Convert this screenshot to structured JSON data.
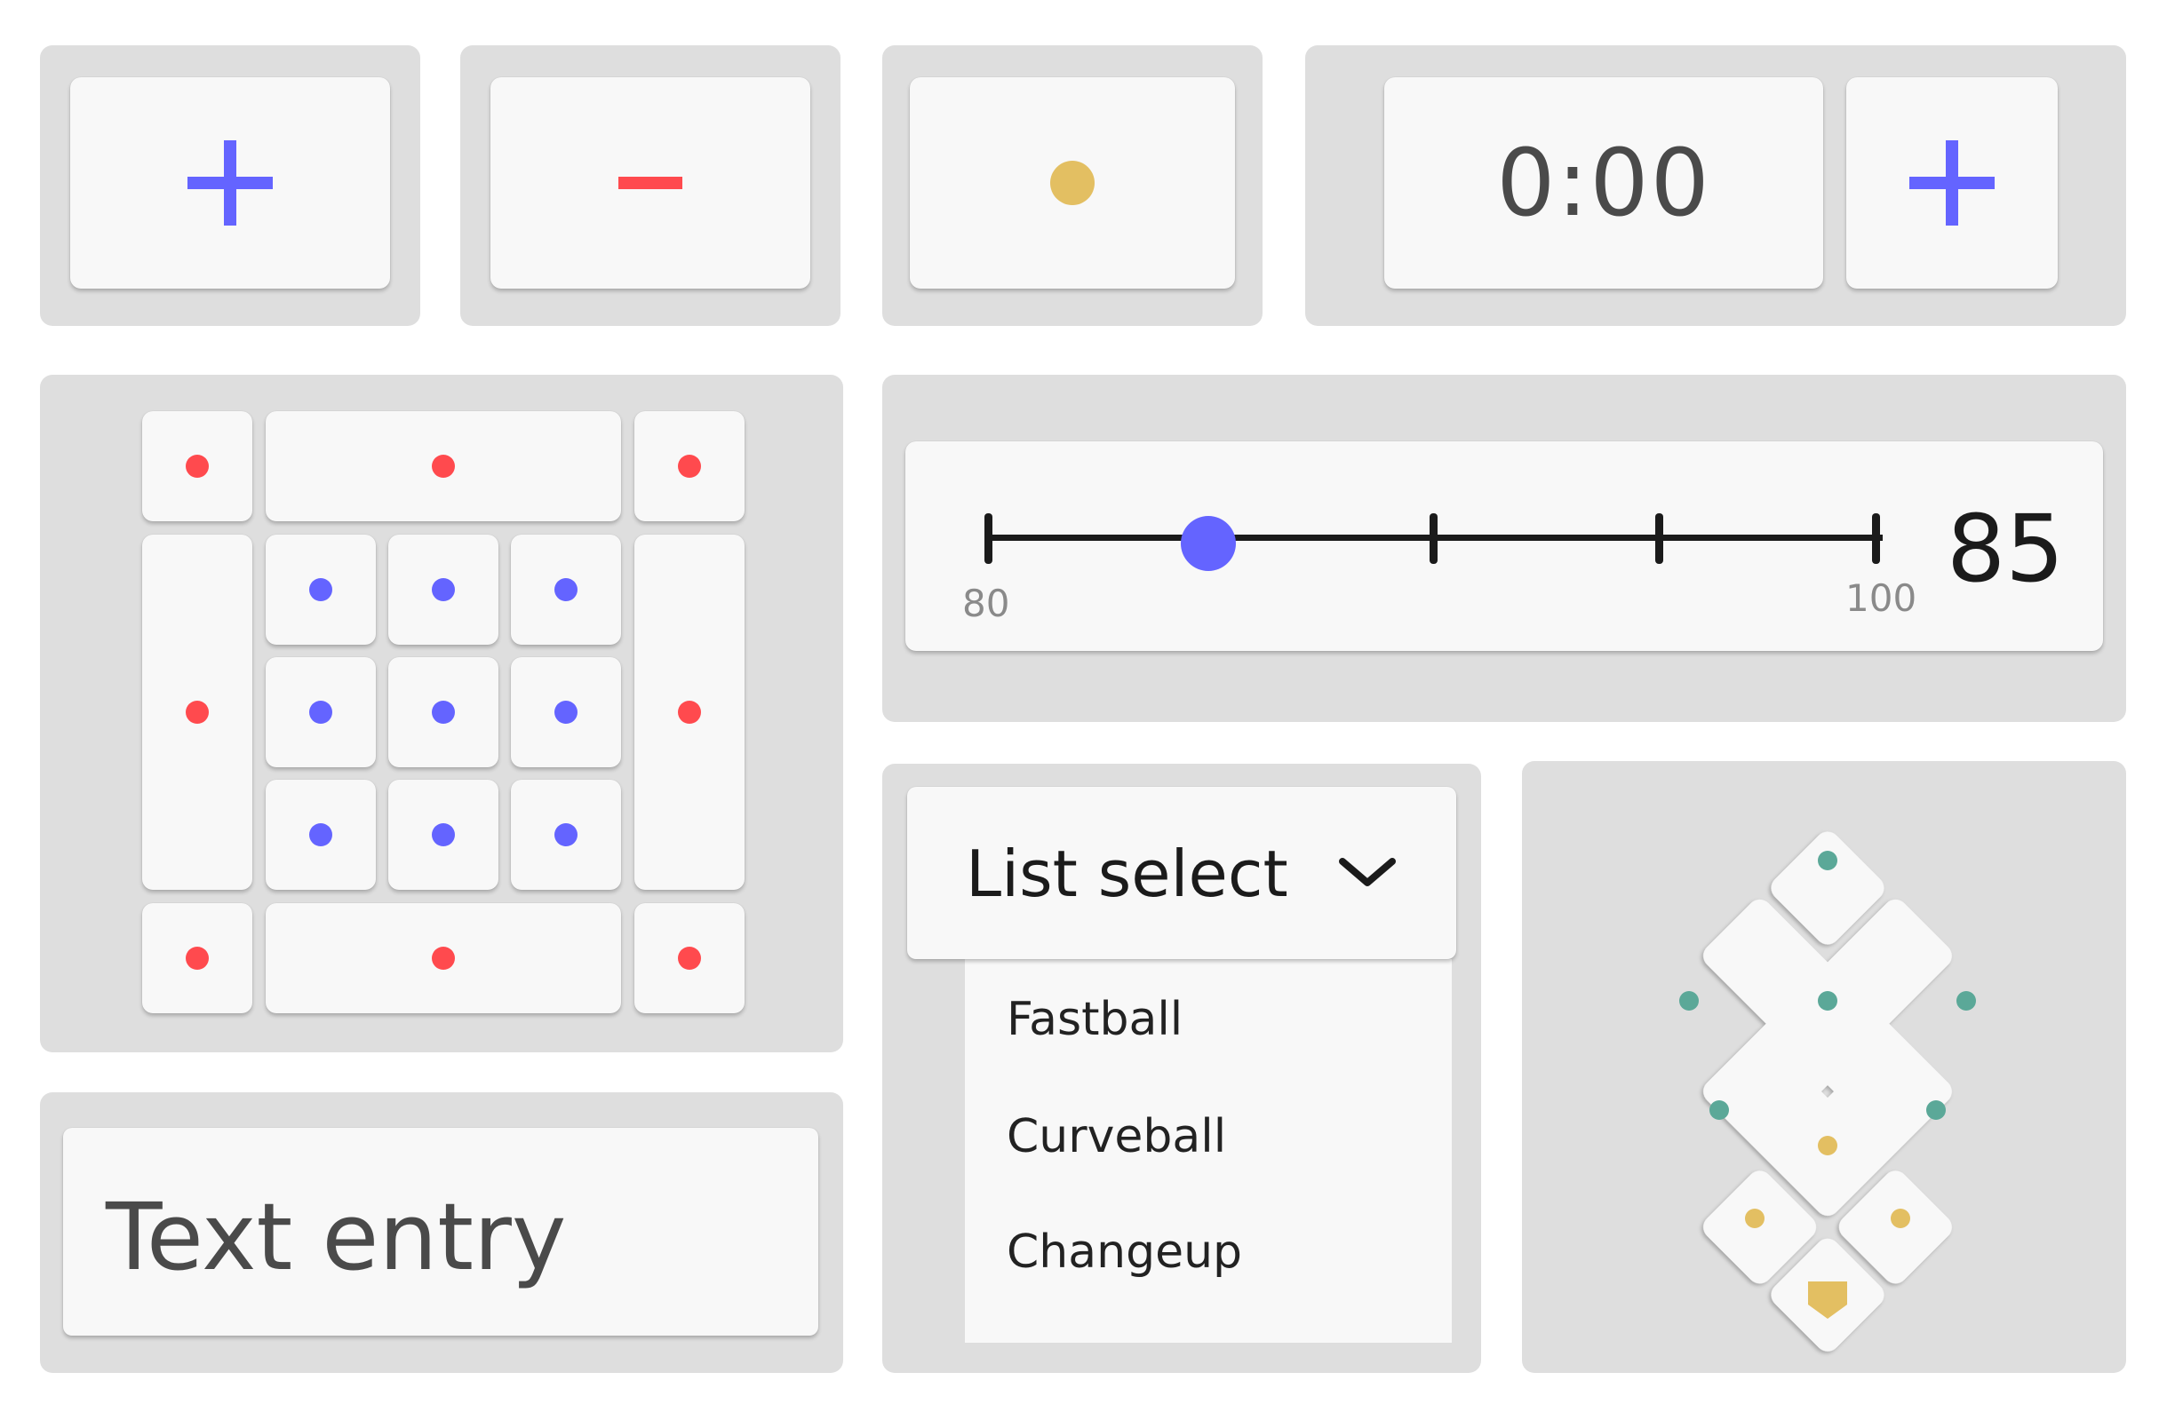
{
  "colors": {
    "accent": "#6464ff",
    "danger": "#ff4a4e",
    "yellow": "#e3bf62",
    "teal": "#5ba898",
    "panel": "#dedede",
    "card": "#f8f8f8",
    "text": "#222222",
    "muted": "#4a4a4a"
  },
  "buttons": {
    "increment_icon": "plus-icon",
    "decrement_icon": "minus-icon",
    "dot_icon": "dot-icon"
  },
  "timer": {
    "display": "0:00",
    "add_icon": "plus-icon"
  },
  "slider": {
    "min_label": "80",
    "max_label": "100",
    "value_label": "85",
    "value": 85,
    "min": 80,
    "max": 100
  },
  "select": {
    "label": "List select",
    "chevron": "chevron-down-icon",
    "options": [
      "Fastball",
      "Curveball",
      "Changeup"
    ]
  },
  "text_entry": {
    "placeholder": "Text entry"
  },
  "zone_grid": {
    "outer_dot_color": "#ff4a4e",
    "inner_dot_color": "#6464ff"
  },
  "diamond": {
    "home_plate_icon": "home-plate-icon"
  }
}
